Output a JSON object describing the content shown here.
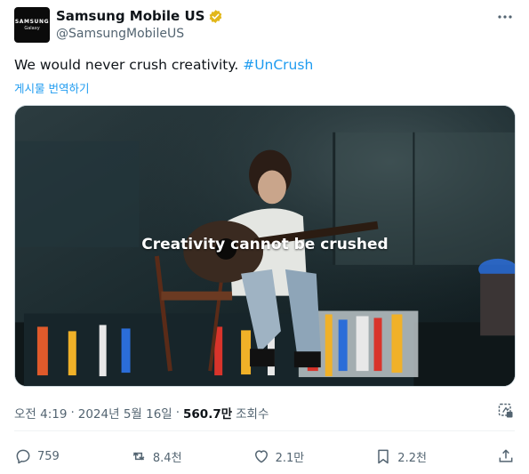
{
  "account": {
    "avatar_brand": "SAMSUNG",
    "avatar_sub": "Galaxy",
    "display_name": "Samsung Mobile US",
    "handle": "@SamsungMobileUS"
  },
  "tweet": {
    "text": "We would never crush creativity. ",
    "hashtag": "#UnCrush",
    "translate_label": "게시물 번역하기",
    "media_caption": "Creativity cannot be crushed"
  },
  "meta": {
    "time": "오전 4:19",
    "date": "2024년 5월 16일",
    "views": "560.7만",
    "views_label": "조회수"
  },
  "actions": {
    "replies": "759",
    "reposts": "8.4천",
    "likes": "2.1만",
    "bookmarks": "2.2천"
  },
  "colors": {
    "accent": "#1d9bf0",
    "verified": "#e2b719",
    "muted": "#536471"
  },
  "icons": [
    "more-icon",
    "verified-badge-icon",
    "grok-icon",
    "reply-icon",
    "repost-icon",
    "like-icon",
    "bookmark-icon",
    "share-icon"
  ]
}
